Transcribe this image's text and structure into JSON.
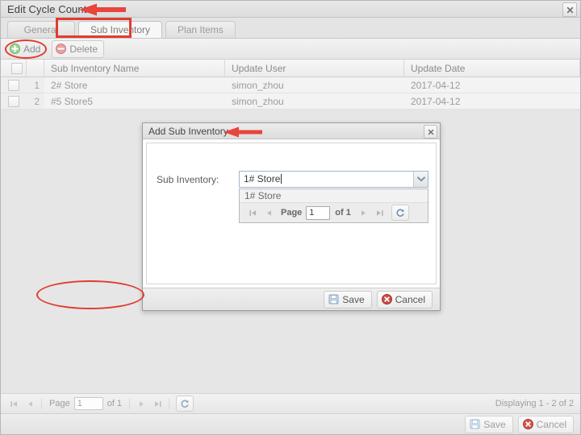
{
  "window": {
    "title": "Edit Cycle Count",
    "close_label": "✖"
  },
  "tabs": [
    {
      "label": "General",
      "active": false
    },
    {
      "label": "Sub Inventory",
      "active": true
    },
    {
      "label": "Plan Items",
      "active": false
    }
  ],
  "toolbar": {
    "add_label": "Add",
    "delete_label": "Delete",
    "add_icon": "circle-plus-icon",
    "delete_icon": "circle-minus-icon"
  },
  "grid": {
    "columns": [
      "",
      "",
      "Sub Inventory Name",
      "Update User",
      "Update Date"
    ],
    "rows": [
      {
        "num": "1",
        "name": "2# Store",
        "user": "simon_zhou",
        "date": "2017-04-12"
      },
      {
        "num": "2",
        "name": "#5 Store5",
        "user": "simon_zhou",
        "date": "2017-04-12"
      }
    ]
  },
  "pager": {
    "first_icon": "◀│",
    "prev_icon": "◀",
    "page_label": "Page",
    "page_value": "1",
    "of_label": "of 1",
    "next_icon": "▶",
    "last_icon": "│▶",
    "refresh_icon": "refresh-icon",
    "display_text": "Displaying 1 - 2 of 2"
  },
  "footer": {
    "save_label": "Save",
    "cancel_label": "Cancel",
    "save_icon": "floppy-disk-icon",
    "cancel_icon": "circle-x-icon"
  },
  "modal": {
    "title": "Add Sub Inventory",
    "close_label": "✖",
    "field_label": "Sub Inventory:",
    "combo_value": "1# Store",
    "combo_trigger_icon": "chevron-down-icon",
    "options": [
      "1# Store"
    ],
    "pager": {
      "page_label": "Page",
      "page_value": "1",
      "of_label": "of 1",
      "refresh_icon": "refresh-icon"
    },
    "save_label": "Save",
    "cancel_label": "Cancel",
    "save_icon": "floppy-disk-icon",
    "cancel_icon": "circle-x-icon"
  },
  "annotations": {
    "accent_color": "#e03c31",
    "title_arrow": "left-arrow",
    "modal_title_arrow": "left-arrow",
    "tab_highlight": "rectangle",
    "add_highlight": "ellipse",
    "modal_buttons_highlight": "ellipse"
  }
}
